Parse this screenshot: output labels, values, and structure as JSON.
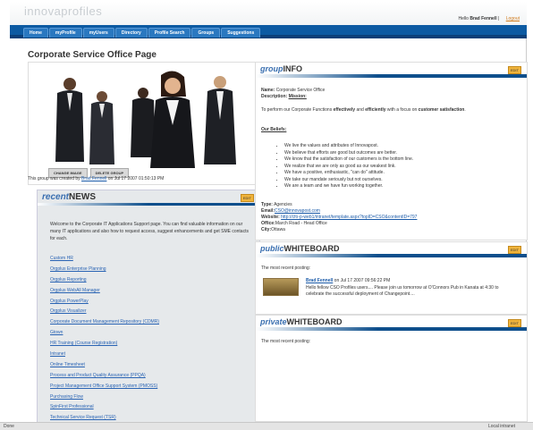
{
  "app": {
    "logo": "innovaprofiles"
  },
  "user": {
    "hello_prefix": "Hello ",
    "name": "Brad Fennell",
    "logout": "Logout"
  },
  "nav": {
    "items": [
      "Home",
      "myProfile",
      "myUsers",
      "Directory",
      "Profile Search",
      "Groups",
      "Suggestions"
    ]
  },
  "page": {
    "title": "Corporate Service Office Page"
  },
  "photo": {
    "buttons": [
      "CHANGE IMAGE",
      "DELETE GROUP"
    ],
    "created_prefix": "This group was created by ",
    "created_by": "Brad Fennell",
    "created_suffix": " on Jul 17 2007 01:50:13 PM"
  },
  "group_info": {
    "title_a": "group",
    "title_b": "INFO",
    "edit": "EDIT",
    "name_label": "Name:",
    "name_value": "Corporate Service Office",
    "description_label": "Description:",
    "mission_label": "Mission:",
    "mission_pre": "To perform our Corporate Functions ",
    "mission_b1": "effectively",
    "mission_mid": " and ",
    "mission_b2": "efficiently",
    "mission_post": " with a focus on ",
    "mission_b3": "customer satisfaction",
    "mission_end": ".",
    "beliefs_label": "Our Beliefs:",
    "beliefs": [
      "We live the values and attributes of Innovapost.",
      "We believe that efforts are good but outcomes are better.",
      "We know that the satisfaction of our customers is the bottom line.",
      "We realize that we are only as good as our weakest link.",
      "We have a positive, enthusiastic, \"can do\" attitude.",
      "We take our mandate seriously but not ourselves.",
      "We are a team and we have fun working together."
    ],
    "type_label": "Type:",
    "type_value": "Agencies",
    "email_label": "Email:",
    "email_value": "CSO@innovapost.com",
    "website_label": "Website:",
    "website_value": "http://cfo-p-web1/intranet/template.aspx?topID=CSO&contentID=797",
    "office_label": "Office:",
    "office_value": "March Road - Head Office",
    "city_label": "City:",
    "city_value": "Ottawa"
  },
  "news": {
    "title_a": "recent",
    "title_b": "NEWS",
    "edit": "EDIT",
    "intro": "Welcome to the Corporate IT Applications Support page. You can find valuable information on our many IT applications and also how to request access, suggest enhancements and get SME contacts for each.",
    "links": [
      "Custom HR",
      "Orgplus Enterprise Planning",
      "Orgplus Reporting",
      "Orgplus WebAll Manager",
      "Orgplus PowerPlay",
      "Orgplus Visualizer",
      "Corporate Document Management Repository (CDMR)",
      "Gtown",
      "HR Training (Course Registration)",
      "Intranet",
      "Online Timesheet",
      "Process and Product Quality Assurance (PPQA)",
      "Project Management Office Support System (PMOSS)",
      "Purchasing Flow",
      "SpinFirst Professional",
      "Technical Service Request (TSR)"
    ]
  },
  "public_wb": {
    "title_a": "public",
    "title_b": "WHITEBOARD",
    "edit": "EDIT",
    "recent_label": "The most recent posting:",
    "author": "Brad Fennell",
    "posted": " on Jul 17 2007 09:56:22 PM",
    "body": "Hello fellow CSO Profiles users.... Please join us tomorrow at O'Connors Pub in Kanata at 4:30 to celebrate the successful deployment of Changepoint...."
  },
  "private_wb": {
    "title_a": "private",
    "title_b": "WHITEBOARD",
    "edit": "EDIT",
    "recent_label": "The most recent posting:"
  },
  "statusbar": {
    "left": "Done",
    "right": "Local intranet"
  }
}
